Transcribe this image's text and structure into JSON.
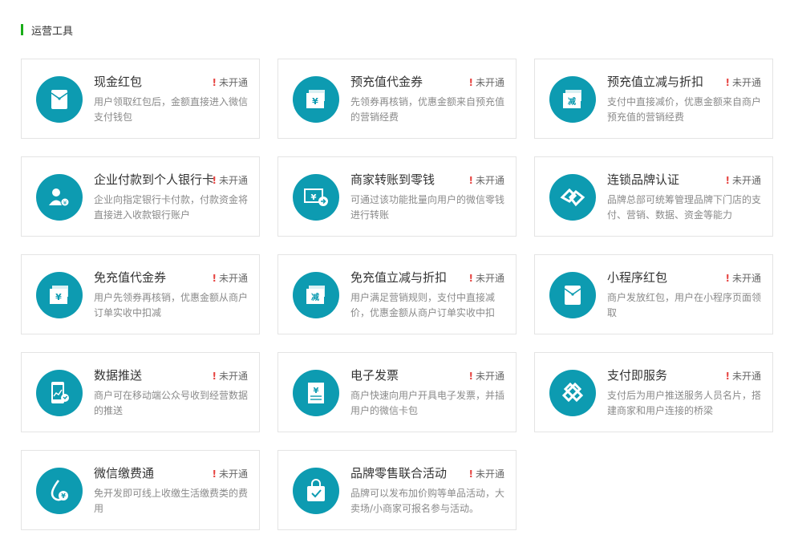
{
  "section": {
    "title": "运营工具"
  },
  "status_label": "未开通",
  "status_mark": "!",
  "accent_color": "#0d9bb1",
  "cards": [
    {
      "title": "现金红包",
      "desc": "用户领取红包后，金额直接进入微信支付钱包",
      "icon": "red-packet-icon"
    },
    {
      "title": "预充值代金券",
      "desc": "先领券再核销，优惠金额来自预充值的营销经费",
      "icon": "prepaid-coupon-icon"
    },
    {
      "title": "预充值立减与折扣",
      "desc": "支付中直接减价，优惠金额来自商户预充值的营销经费",
      "icon": "prepaid-discount-icon"
    },
    {
      "title": "企业付款到个人银行卡",
      "desc": "企业向指定银行卡付款，付款资金将直接进入收款银行账户",
      "icon": "enterprise-pay-icon"
    },
    {
      "title": "商家转账到零钱",
      "desc": "可通过该功能批量向用户的微信零钱进行转账",
      "icon": "merchant-transfer-icon"
    },
    {
      "title": "连锁品牌认证",
      "desc": "品牌总部可统筹管理品牌下门店的支付、营销、数据、资金等能力",
      "icon": "chain-brand-icon"
    },
    {
      "title": "免充值代金券",
      "desc": "用户先领券再核销，优惠金额从商户订单实收中扣减",
      "icon": "free-coupon-icon"
    },
    {
      "title": "免充值立减与折扣",
      "desc": "用户满足营销规则，支付中直接减价，优惠金额从商户订单实收中扣",
      "icon": "free-discount-icon"
    },
    {
      "title": "小程序红包",
      "desc": "商户发放红包，用户在小程序页面领取",
      "icon": "mini-program-red-packet-icon"
    },
    {
      "title": "数据推送",
      "desc": "商户可在移动端公众号收到经营数据的推送",
      "icon": "data-push-icon"
    },
    {
      "title": "电子发票",
      "desc": "商户快速向用户开具电子发票，并插用户的微信卡包",
      "icon": "e-invoice-icon"
    },
    {
      "title": "支付即服务",
      "desc": "支付后为用户推送服务人员名片，搭建商家和用户连接的桥梁",
      "icon": "pay-service-icon"
    },
    {
      "title": "微信缴费通",
      "desc": "免开发即可线上收缴生活缴费类的费用",
      "icon": "bill-pay-icon"
    },
    {
      "title": "品牌零售联合活动",
      "desc": "品牌可以发布加价购等单品活动，大卖场/小商家可报名参与活动。",
      "icon": "shopping-bag-icon"
    }
  ]
}
